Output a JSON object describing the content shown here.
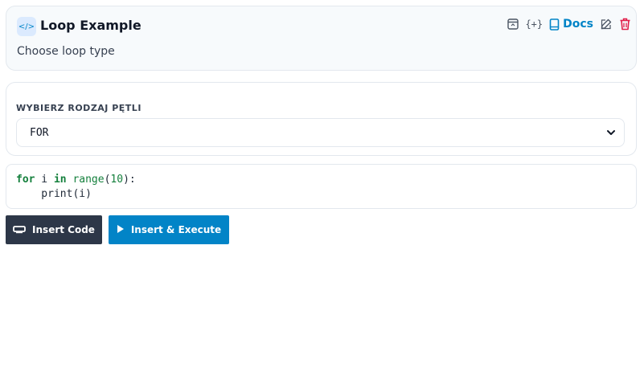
{
  "header": {
    "title": "Loop Example",
    "subtitle": "Choose loop type",
    "badge_icon": "code-icon",
    "toolbar": {
      "panel_icon": "window-icon",
      "braces_text": "{+}",
      "docs_label": "Docs",
      "docs_icon": "book-icon",
      "edit_icon": "pencil-icon",
      "delete_icon": "trash-icon"
    }
  },
  "selector": {
    "label": "WYBIERZ RODZAJ PĘTLI",
    "selected": "FOR",
    "icon": "chevron-down-icon"
  },
  "code": {
    "line1": {
      "kw1": "for",
      "var": " i ",
      "kw2": "in",
      "fn": " range",
      "open": "(",
      "num": "10",
      "close": "):"
    },
    "line2": "    print(i)"
  },
  "buttons": {
    "insert_label": "Insert Code",
    "execute_label": "Insert & Execute"
  },
  "colors": {
    "accent": "#0284c7",
    "dark_button": "#2d3748",
    "danger": "#e11d48",
    "code_keyword": "#15803d"
  }
}
